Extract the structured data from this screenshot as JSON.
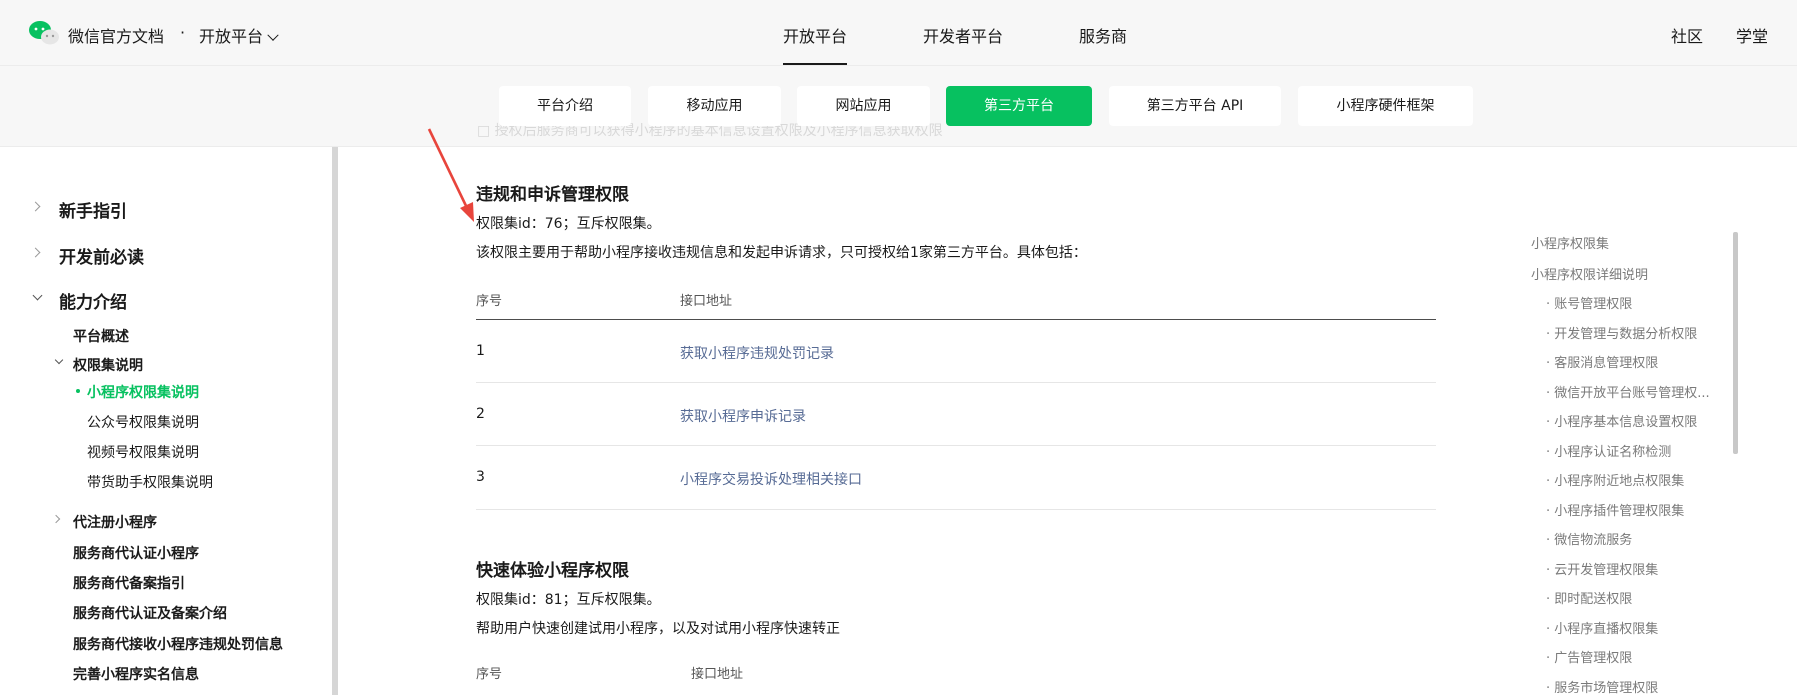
{
  "header": {
    "brand": "微信官方文档",
    "separator": "·",
    "platform_label": "开放平台",
    "nav": [
      "开放平台",
      "开发者平台",
      "服务商"
    ],
    "right_nav": [
      "社区",
      "学堂"
    ]
  },
  "subnav": {
    "tabs": [
      "平台介绍",
      "移动应用",
      "网站应用",
      "第三方平台",
      "第三方平台 API",
      "小程序硬件框架"
    ],
    "active": "第三方平台",
    "faded_behind": "□ 授权后服务商可以获得小程序的基本信息设置权限及小程序信息获取权限"
  },
  "sidebar": {
    "sections": [
      "新手指引",
      "开发前必读",
      "能力介绍"
    ],
    "items": [
      "平台概述",
      "权限集说明",
      "小程序权限集说明",
      "公众号权限集说明",
      "视频号权限集说明",
      "带货助手权限集说明",
      "代注册小程序",
      "服务商代认证小程序",
      "服务商代备案指引",
      "服务商代认证及备案介绍",
      "服务商代接收小程序违规处罚信息",
      "完善小程序实名信息"
    ]
  },
  "main": {
    "section1": {
      "title": "违规和申诉管理权限",
      "id_line": "权限集id：76；互斥权限集。",
      "desc": "该权限主要用于帮助小程序接收违规信息和发起申诉请求，只可授权给1家第三方平台。具体包括：",
      "col_no": "序号",
      "col_api": "接口地址",
      "rows": [
        {
          "no": "1",
          "api": "获取小程序违规处罚记录"
        },
        {
          "no": "2",
          "api": "获取小程序申诉记录"
        },
        {
          "no": "3",
          "api": "小程序交易投诉处理相关接口"
        }
      ]
    },
    "section2": {
      "title": "快速体验小程序权限",
      "id_line": "权限集id：81；互斥权限集。",
      "desc": "帮助用户快速创建试用小程序，以及对试用小程序快速转正",
      "col_no": "序号",
      "col_api": "接口地址"
    }
  },
  "toc": {
    "items": [
      "小程序权限集",
      "小程序权限详细说明",
      "· 账号管理权限",
      "· 开发管理与数据分析权限",
      "· 客服消息管理权限",
      "· 微信开放平台账号管理权...",
      "· 小程序基本信息设置权限",
      "· 小程序认证名称检测",
      "· 小程序附近地点权限集",
      "· 小程序插件管理权限集",
      "· 微信物流服务",
      "· 云开发管理权限集",
      "· 即时配送权限",
      "· 小程序直播权限集",
      "· 广告管理权限",
      "· 服务市场管理权限"
    ]
  },
  "colors": {
    "accent": "#07c160",
    "link": "#576b95",
    "annotation_arrow": "#e8453c"
  }
}
